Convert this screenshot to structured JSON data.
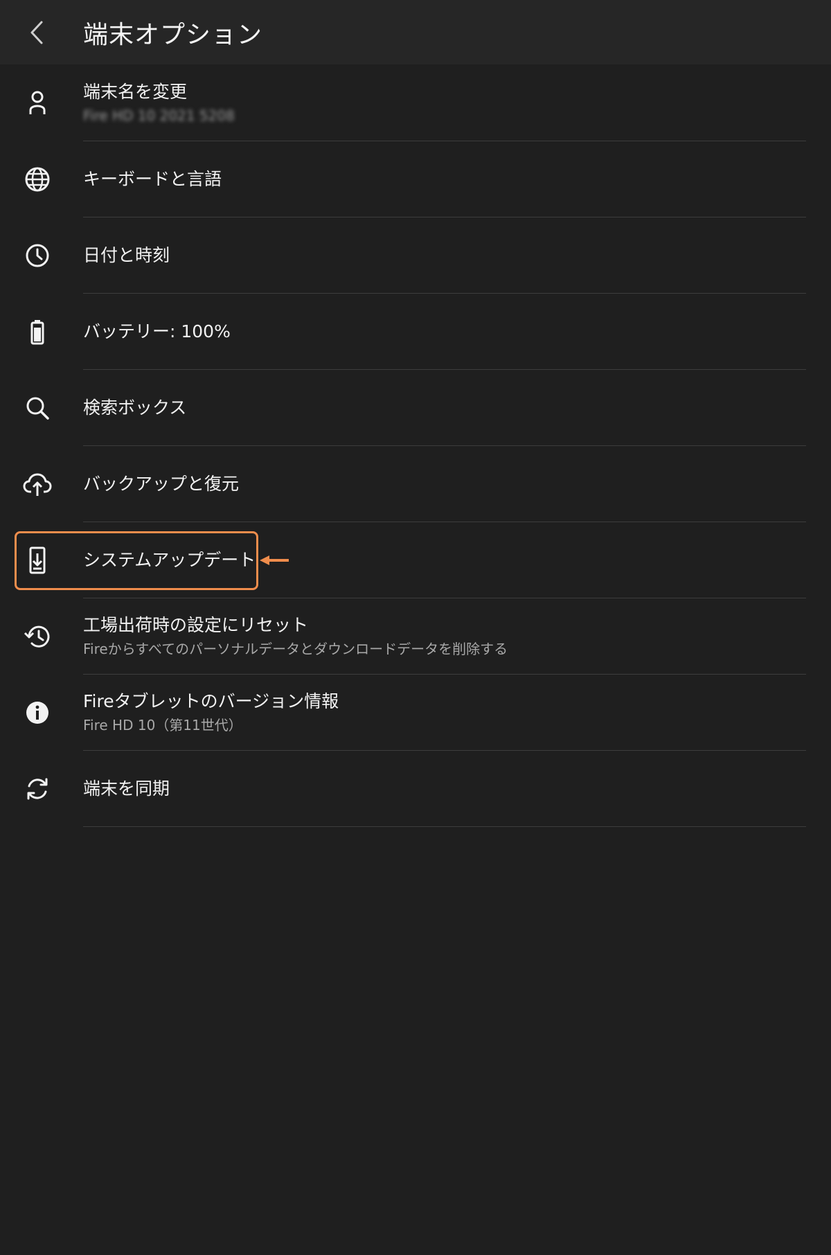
{
  "header": {
    "title": "端末オプション",
    "back_icon": "chevron-left-icon"
  },
  "items": [
    {
      "id": "rename",
      "icon": "person-icon",
      "title": "端末名を変更",
      "subtitle": "Fire HD 10 2021 5208",
      "subtitle_blurred": true
    },
    {
      "id": "keyboard",
      "icon": "globe-icon",
      "title": "キーボードと言語",
      "subtitle": ""
    },
    {
      "id": "datetime",
      "icon": "clock-icon",
      "title": "日付と時刻",
      "subtitle": ""
    },
    {
      "id": "battery",
      "icon": "battery-icon",
      "title": "バッテリー: 100%",
      "subtitle": ""
    },
    {
      "id": "search",
      "icon": "search-icon",
      "title": "検索ボックス",
      "subtitle": ""
    },
    {
      "id": "backup",
      "icon": "cloud-upload-icon",
      "title": "バックアップと復元",
      "subtitle": ""
    },
    {
      "id": "system-update",
      "icon": "system-update-icon",
      "title": "システムアップデート",
      "subtitle": ""
    },
    {
      "id": "factory-reset",
      "icon": "history-icon",
      "title": "工場出荷時の設定にリセット",
      "subtitle": "Fireからすべてのパーソナルデータとダウンロードデータを削除する"
    },
    {
      "id": "version",
      "icon": "info-icon",
      "title": "Fireタブレットのバージョン情報",
      "subtitle": "Fire HD 10（第11世代）"
    },
    {
      "id": "sync",
      "icon": "sync-icon",
      "title": "端末を同期",
      "subtitle": ""
    }
  ],
  "annotation": {
    "highlight_color": "#f08d4c",
    "highlighted_item": "system-update"
  },
  "colors": {
    "background": "#1f1f1f",
    "header_background": "#262626",
    "divider": "#3d3d3d",
    "text_primary": "#f2f2f2",
    "text_secondary": "#a8a8a8"
  }
}
